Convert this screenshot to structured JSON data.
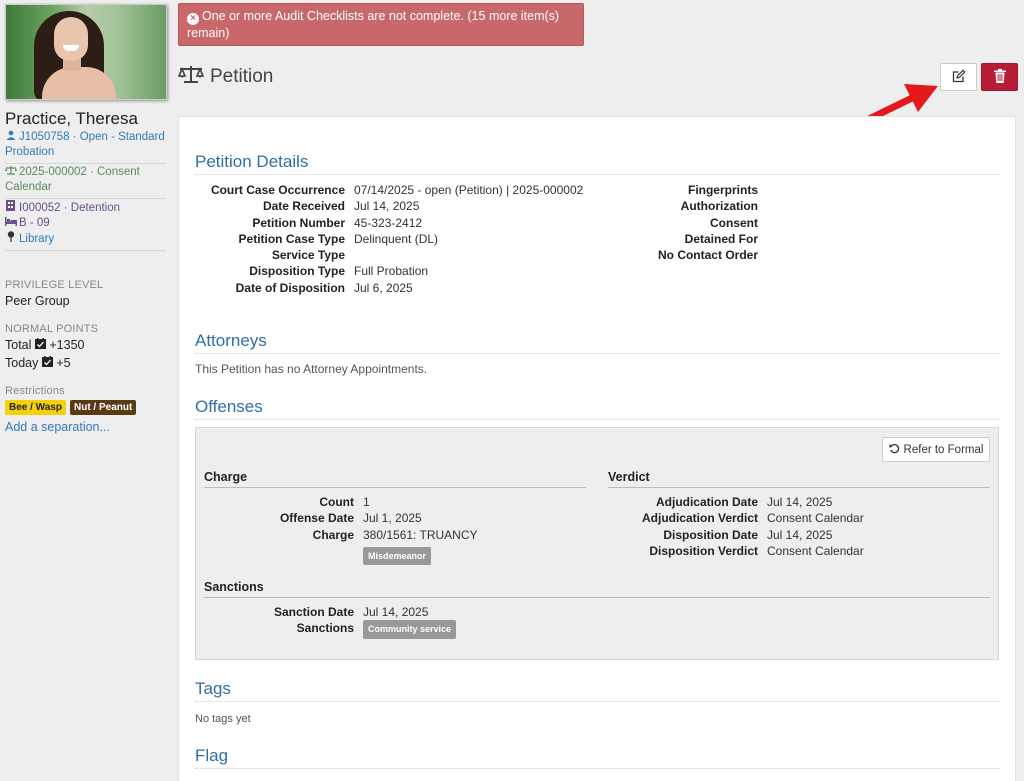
{
  "alert": {
    "message": "One or more Audit Checklists are not complete. (15 more item(s) remain)"
  },
  "sidebar": {
    "name": "Practice, Theresa",
    "id_line": "J1050758 · Open - Standard Probation",
    "case_line": "2025-000002 · Consent Calendar",
    "location_line": "I000052 · Detention",
    "bed_line": "B - 09",
    "room_line": "Library",
    "privilege_label": "PRIVILEGE LEVEL",
    "privilege_value": "Peer Group",
    "points_label": "NORMAL POINTS",
    "points_total": "Total",
    "points_total_value": "+1350",
    "points_today": "Today",
    "points_today_value": "+5",
    "restrictions_label": "Restrictions",
    "restrictions": [
      "Bee / Wasp",
      "Nut / Peanut"
    ],
    "add_separation": "Add a separation..."
  },
  "page": {
    "title": "Petition"
  },
  "details": {
    "title": "Petition Details",
    "left": [
      {
        "k": "Court Case Occurrence",
        "v": "07/14/2025 - open (Petition) | 2025-000002"
      },
      {
        "k": "Date Received",
        "v": "Jul 14, 2025"
      },
      {
        "k": "Petition Number",
        "v": "45-323-2412"
      },
      {
        "k": "Petition Case Type",
        "v": "Delinquent (DL)"
      },
      {
        "k": "Service Type",
        "v": ""
      },
      {
        "k": "Disposition Type",
        "v": "Full Probation"
      },
      {
        "k": "Date of Disposition",
        "v": "Jul 6, 2025"
      }
    ],
    "right": [
      {
        "k": "Fingerprints",
        "v": ""
      },
      {
        "k": "Authorization",
        "v": ""
      },
      {
        "k": "Consent",
        "v": ""
      },
      {
        "k": "Detained For",
        "v": ""
      },
      {
        "k": "No Contact Order",
        "v": ""
      }
    ]
  },
  "attorneys": {
    "title": "Attorneys",
    "empty": "This Petition has no Attorney Appointments."
  },
  "offenses": {
    "title": "Offenses",
    "refer_label": "Refer to Formal",
    "charge_heading": "Charge",
    "verdict_heading": "Verdict",
    "charge_rows": [
      {
        "k": "Count",
        "v": "1"
      },
      {
        "k": "Offense Date",
        "v": "Jul 1, 2025"
      },
      {
        "k": "Charge",
        "v": "380/1561: TRUANCY"
      }
    ],
    "charge_tag": "Misdemeanor",
    "verdict_rows": [
      {
        "k": "Adjudication Date",
        "v": "Jul 14, 2025"
      },
      {
        "k": "Adjudication Verdict",
        "v": "Consent Calendar"
      },
      {
        "k": "Disposition Date",
        "v": "Jul 14, 2025"
      },
      {
        "k": "Disposition Verdict",
        "v": "Consent Calendar"
      }
    ],
    "sanctions_heading": "Sanctions",
    "sanction_date_label": "Sanction Date",
    "sanction_date": "Jul 14, 2025",
    "sanctions_label": "Sanctions",
    "sanctions_tag": "Community service"
  },
  "tags": {
    "title": "Tags",
    "empty": "No tags yet"
  },
  "flag": {
    "title": "Flag"
  },
  "colors": {
    "accent": "#2f6fa5",
    "alert": "#c9686a",
    "delete": "#b71c36",
    "arrow": "#e3191b"
  }
}
